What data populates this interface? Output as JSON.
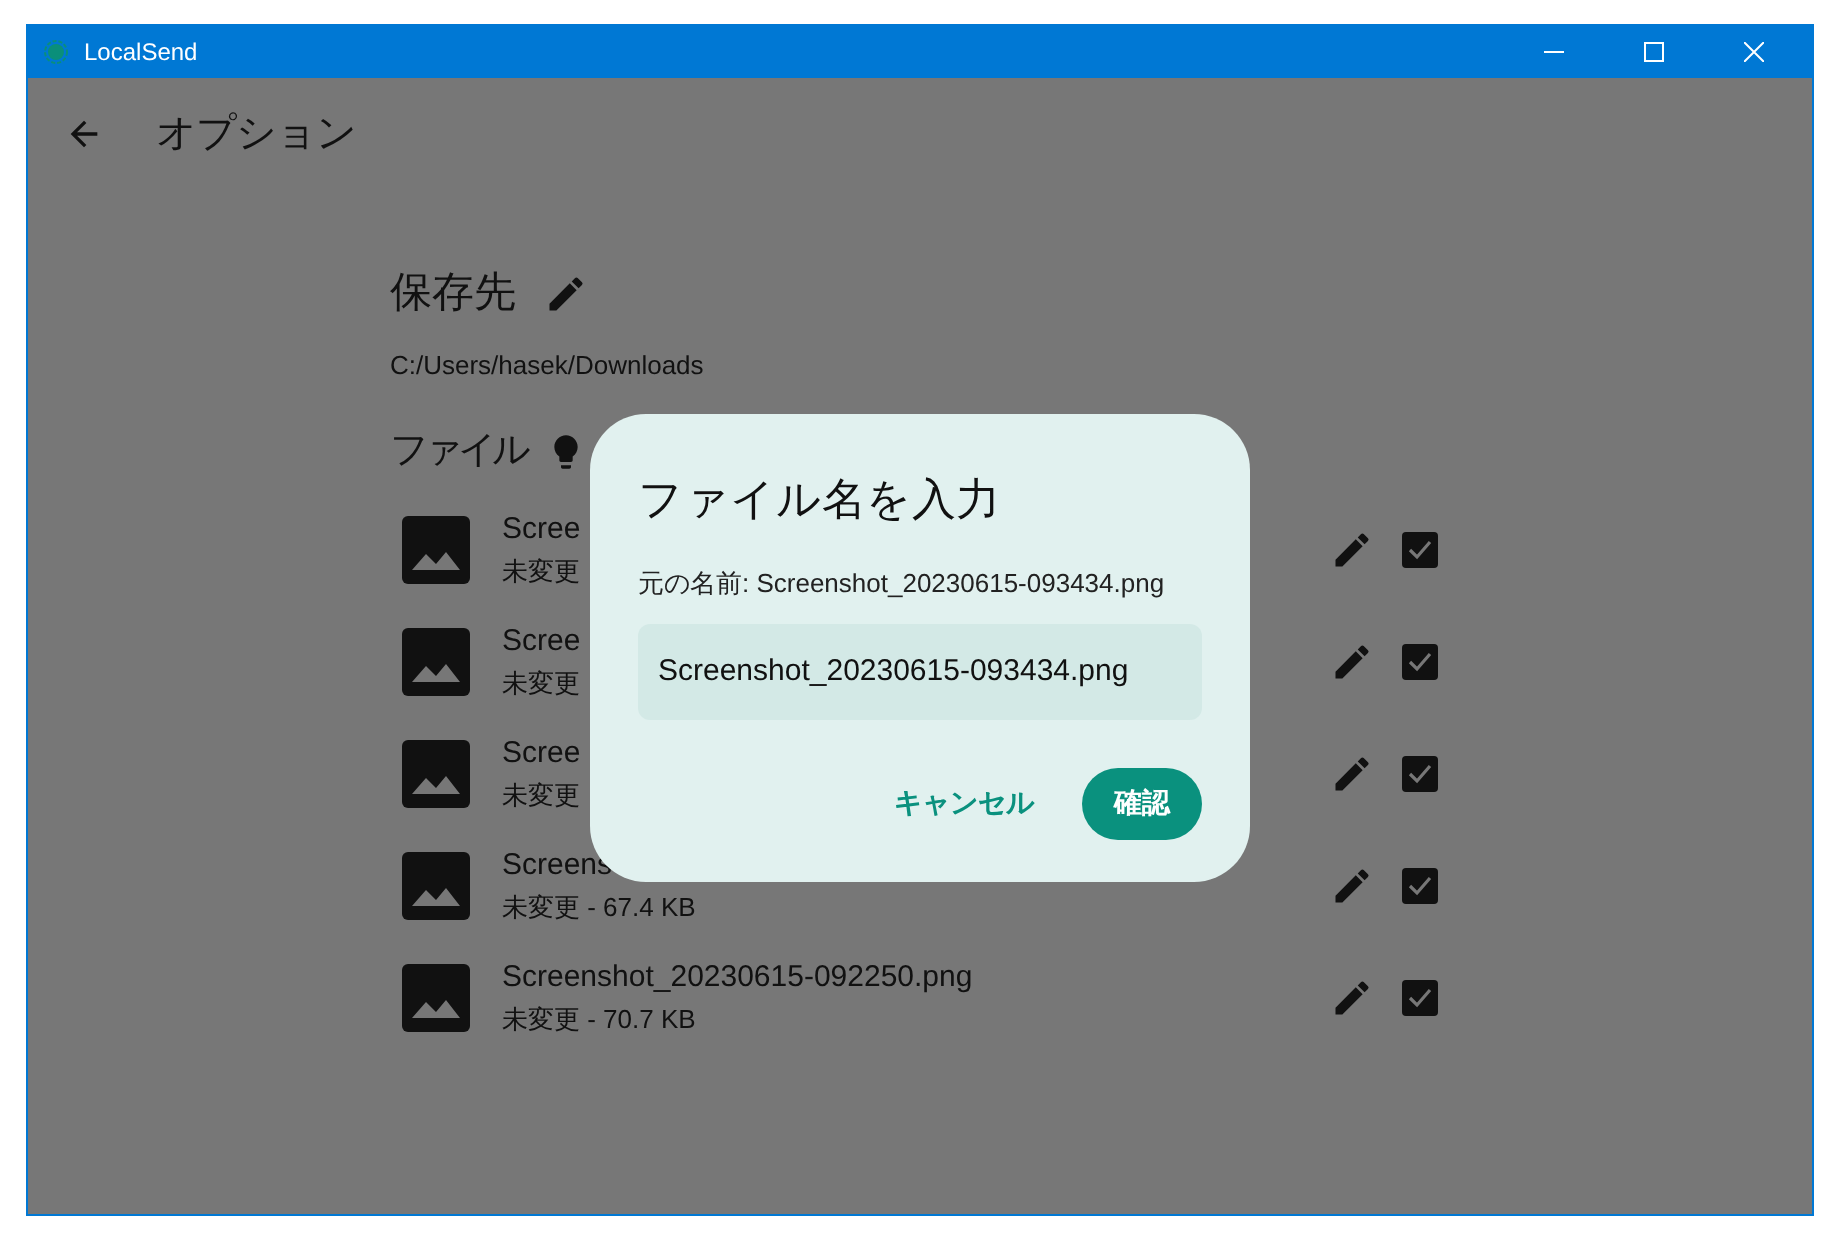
{
  "window": {
    "title": "LocalSend"
  },
  "header": {
    "title": "オプション"
  },
  "destination": {
    "heading": "保存先",
    "path": "C:/Users/hasek/Downloads"
  },
  "files": {
    "heading": "ファイル",
    "items": [
      {
        "name": "Scree",
        "meta": "未変更",
        "checked": true
      },
      {
        "name": "Scree",
        "meta": "未変更",
        "checked": true
      },
      {
        "name": "Scree",
        "meta": "未変更",
        "checked": true
      },
      {
        "name": "Screens",
        "meta": "未変更 - 67.4 KB",
        "checked": true
      },
      {
        "name": "Screenshot_20230615-092250.png",
        "meta": "未変更 - 70.7 KB",
        "checked": true
      }
    ]
  },
  "dialog": {
    "title": "ファイル名を入力",
    "original": "元の名前: Screenshot_20230615-093434.png",
    "value": "Screenshot_20230615-093434.png",
    "buttons": [
      {
        "label": "キャンセル",
        "kind": "text"
      },
      {
        "label": "確認",
        "kind": "filled"
      }
    ]
  }
}
